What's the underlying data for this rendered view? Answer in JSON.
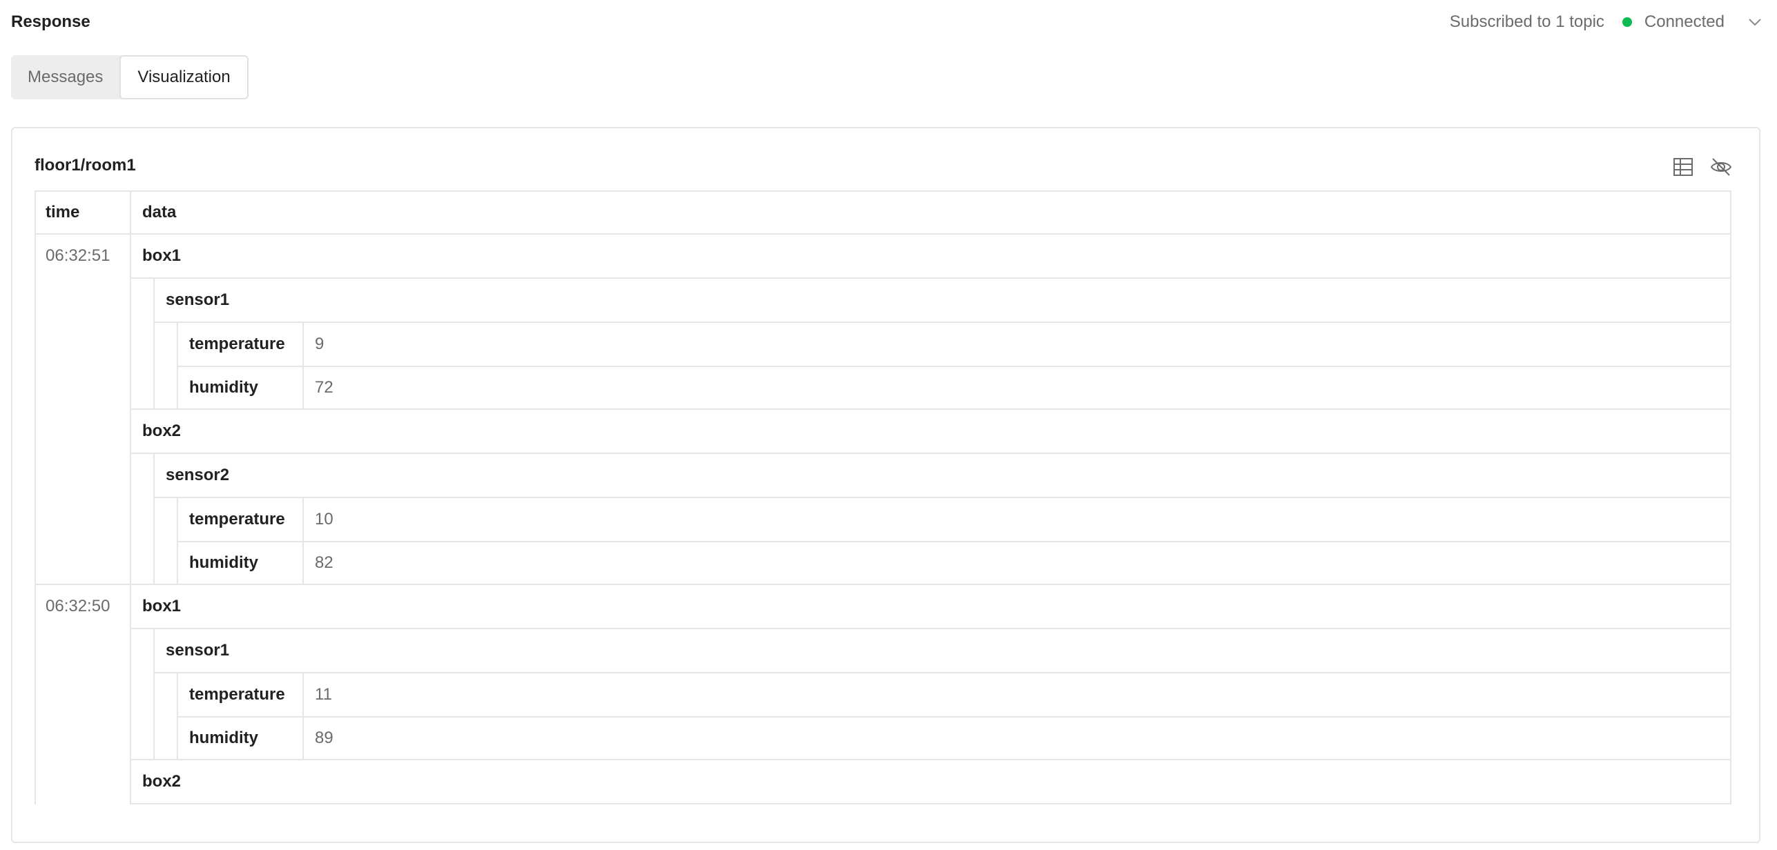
{
  "header": {
    "title": "Response",
    "subscription": "Subscribed to 1 topic",
    "status": "Connected",
    "status_color": "#0cbb52",
    "dropdown_icon": "chevron-down-icon"
  },
  "tabs": [
    {
      "label": "Messages",
      "active": false
    },
    {
      "label": "Visualization",
      "active": true
    }
  ],
  "panel": {
    "topic": "floor1/room1",
    "icons": [
      "table-icon",
      "eye-off-icon"
    ]
  },
  "table": {
    "columns": [
      "time",
      "data"
    ],
    "messages": [
      {
        "time": "06:32:51",
        "boxes": [
          {
            "box": "box1",
            "sensor": "sensor1",
            "fields": [
              {
                "key": "temperature",
                "value": "9"
              },
              {
                "key": "humidity",
                "value": "72"
              }
            ]
          },
          {
            "box": "box2",
            "sensor": "sensor2",
            "fields": [
              {
                "key": "temperature",
                "value": "10"
              },
              {
                "key": "humidity",
                "value": "82"
              }
            ]
          }
        ]
      },
      {
        "time": "06:32:50",
        "boxes": [
          {
            "box": "box1",
            "sensor": "sensor1",
            "fields": [
              {
                "key": "temperature",
                "value": "11"
              },
              {
                "key": "humidity",
                "value": "89"
              }
            ]
          },
          {
            "box": "box2",
            "sensor": "",
            "fields": []
          }
        ]
      }
    ]
  }
}
